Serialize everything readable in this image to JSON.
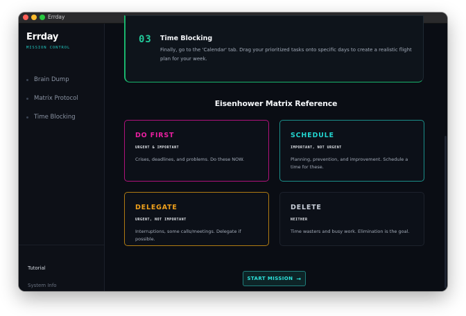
{
  "window": {
    "title": "Errday"
  },
  "sidebar": {
    "brand": "Errday",
    "subtitle": "MISSION CONTROL",
    "items": [
      {
        "label": "Brain Dump"
      },
      {
        "label": "Matrix Protocol"
      },
      {
        "label": "Time Blocking"
      }
    ],
    "footer": {
      "tutorial": "Tutorial",
      "system_info": "System Info"
    }
  },
  "step": {
    "number": "03",
    "title": "Time Blocking",
    "description": "Finally, go to the 'Calendar' tab. Drag your prioritized tasks onto specific days to create a realistic flight plan for your week."
  },
  "matrix": {
    "heading": "Eisenhower Matrix Reference",
    "quadrants": [
      {
        "title": "DO FIRST",
        "tag": "URGENT & IMPORTANT",
        "description": "Crises, deadlines, and problems. Do these NOW.",
        "color": "#ea1fa0"
      },
      {
        "title": "SCHEDULE",
        "tag": "IMPORTANT, NOT URGENT",
        "description": "Planning, prevention, and improvement. Schedule a time for these.",
        "color": "#22d4cf"
      },
      {
        "title": "DELEGATE",
        "tag": "URGENT, NOT IMPORTANT",
        "description": "Interruptions, some calls/meetings. Delegate if possible.",
        "color": "#f0a11c"
      },
      {
        "title": "DELETE",
        "tag": "NEITHER",
        "description": "Time wasters and busy work. Elimination is the goal.",
        "color": "#c8ced8"
      }
    ]
  },
  "cta": {
    "label": "START MISSION",
    "icon": "arrow-right-icon"
  },
  "colors": {
    "accent": "#22d4cf",
    "background": "#0a0d14",
    "success": "#19b56d"
  }
}
